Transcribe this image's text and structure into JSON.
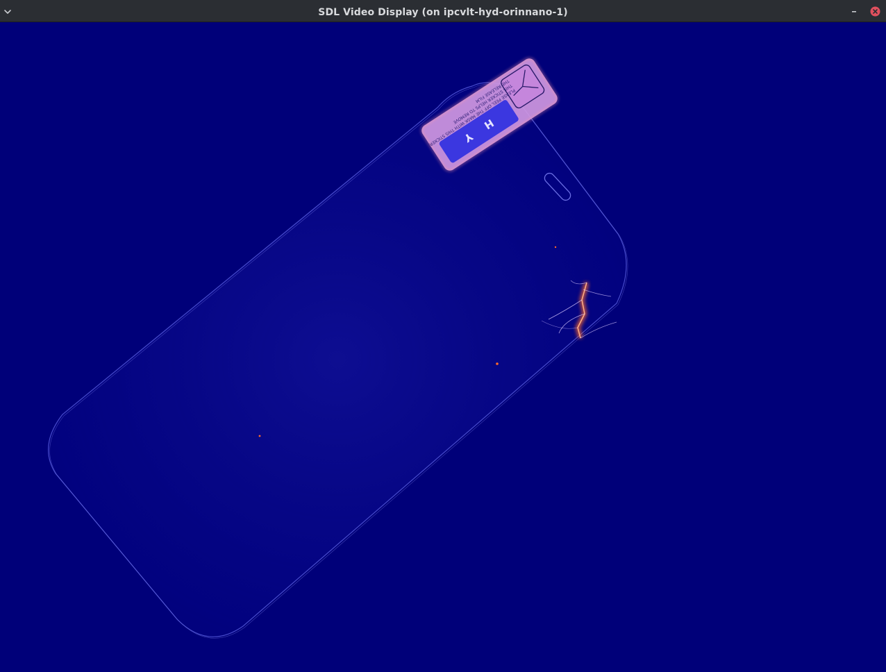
{
  "window": {
    "title": "SDL Video Display (on ipcvlt-hyd-orinnano-1)",
    "menu_icon": "chevron-down-icon",
    "minimize_icon": "minimize-icon",
    "close_icon": "close-icon"
  },
  "display": {
    "background_color": "#000079",
    "glass_outline_color": "#5b5fd6",
    "sticker_color": "#d8a0e6",
    "defect_color": "#ff7a3a",
    "sticker_letters": [
      "Y",
      "H"
    ],
    "sticker_text": [
      "PLEASE PEEL OFF THE MASK WITH THIS STICKER",
      "THIS STICKER HELPS TO REMOVE",
      "THE RELEASE FILM"
    ]
  }
}
